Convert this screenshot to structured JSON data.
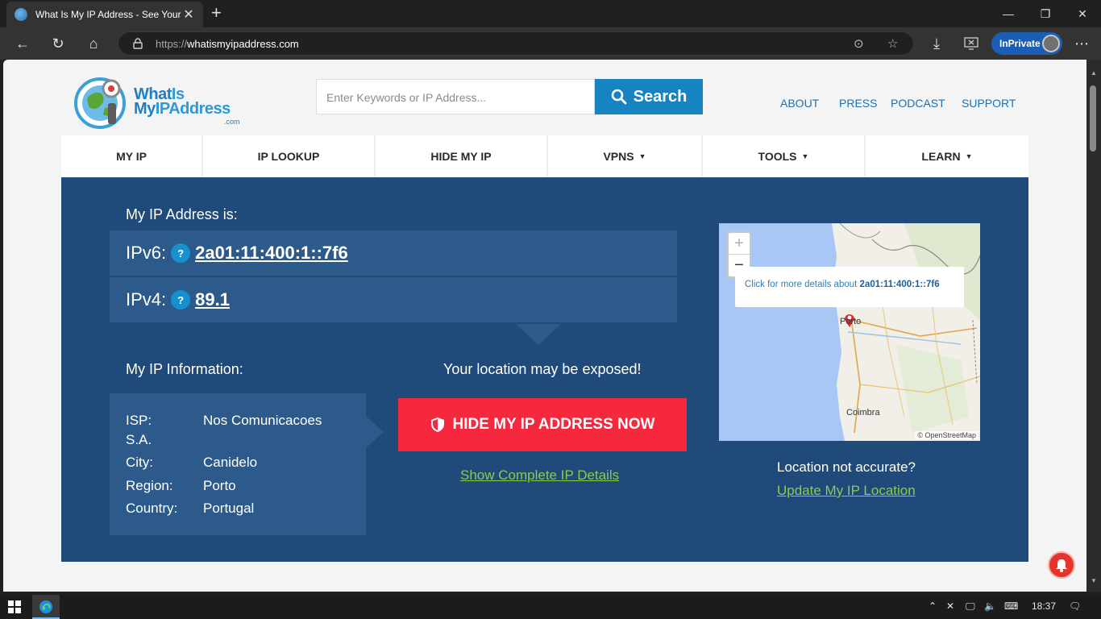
{
  "browser": {
    "tab_title": "What Is My IP Address - See Your",
    "tab_close": "✕",
    "new_tab": "+",
    "url_prefix": "https://",
    "url_host": "whatismyipaddress.com",
    "inprivate_label": "InPrivate",
    "window_controls": {
      "minimize": "—",
      "maximize": "❐",
      "close": "✕"
    },
    "nav": {
      "back": "←",
      "reload": "↻",
      "home": "⌂"
    },
    "toolbar": {
      "reading": "⊙",
      "favorite": "☆",
      "download": "⤓",
      "more": "⋯"
    }
  },
  "site": {
    "logo": {
      "line1_a": "What",
      "line1_b": "Is",
      "line2_a": "My",
      "line2_b": "IPAddress",
      "line3": ".com"
    },
    "search": {
      "placeholder": "Enter Keywords or IP Address...",
      "button": "Search"
    },
    "top_links": [
      "ABOUT",
      "PRESS",
      "PODCAST",
      "SUPPORT"
    ],
    "main_nav": [
      {
        "label": "MY IP",
        "caret": ""
      },
      {
        "label": "IP LOOKUP",
        "caret": ""
      },
      {
        "label": "HIDE MY IP",
        "caret": ""
      },
      {
        "label": "VPNS",
        "caret": "▼"
      },
      {
        "label": "TOOLS",
        "caret": "▼"
      },
      {
        "label": "LEARN",
        "caret": "▼"
      }
    ]
  },
  "hero": {
    "my_ip_label": "My IP Address is:",
    "ipv6_label": "IPv6:",
    "ipv6_value": "2a01:11:400:1::7f6",
    "ipv4_label": "IPv4:",
    "ipv4_value": "89.1",
    "help_mark": "?",
    "info_label": "My IP Information:",
    "info": {
      "isp_key": "ISP:",
      "isp_val": "Nos Comunicacoes",
      "isp_cont": "S.A.",
      "city_key": "City:",
      "city_val": "Canidelo",
      "region_key": "Region:",
      "region_val": "Porto",
      "country_key": "Country:",
      "country_val": "Portugal"
    },
    "exposed_text": "Your location may be exposed!",
    "hide_button": "HIDE MY IP ADDRESS NOW",
    "details_link": "Show Complete IP Details",
    "map": {
      "zoom_in": "+",
      "zoom_out": "−",
      "popup_text": "Click for more details about ",
      "popup_ip": "2a01:11:400:1::7f6",
      "city_porto": "Porto",
      "city_coimbra": "Coimbra",
      "attribution": "© OpenStreetMap"
    },
    "not_accurate": "Location not accurate?",
    "update_link": "Update My IP Location"
  },
  "taskbar": {
    "clock": "18:37"
  },
  "colors": {
    "hero_bg": "#1f4a7a",
    "panel_bg": "#2c5a8a",
    "accent_red": "#f5283d",
    "link_green": "#8ccb4f",
    "search_blue": "#1684c3"
  }
}
